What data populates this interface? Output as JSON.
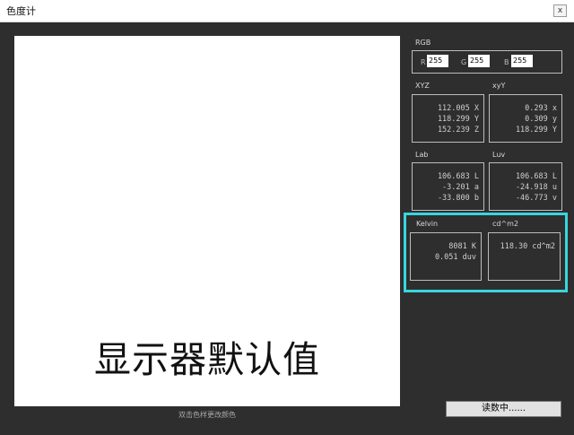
{
  "window": {
    "title": "色度计",
    "close_label": "x"
  },
  "preview": {
    "text": "显示器默认值",
    "hint": "双击色样更改颜色"
  },
  "rgb": {
    "label": "RGB",
    "r_label": "R",
    "r_value": "255",
    "g_label": "G",
    "g_value": "255",
    "b_label": "B",
    "b_value": "255"
  },
  "xyz": {
    "label": "XYZ",
    "line1": "112.005 X",
    "line2": "118.299 Y",
    "line3": "152.239 Z"
  },
  "xyy": {
    "label": "xyY",
    "line1": "0.293 x",
    "line2": "0.309 y",
    "line3": "118.299 Y"
  },
  "lab": {
    "label": "Lab",
    "line1": "106.683 L",
    "line2": "-3.201 a",
    "line3": "-33.800 b"
  },
  "luv": {
    "label": "Luv",
    "line1": "106.683 L",
    "line2": "-24.918 u",
    "line3": "-46.773 v"
  },
  "kelvin": {
    "label": "Kelvin",
    "line1": "8081 K",
    "line2": "0.051 duv"
  },
  "cdm2": {
    "label": "cd^m2",
    "line1": "118.30 cd^m2"
  },
  "read_button": {
    "label": "读数中......"
  },
  "colors": {
    "highlight": "#38d6dc",
    "background": "#2e2e2e"
  }
}
